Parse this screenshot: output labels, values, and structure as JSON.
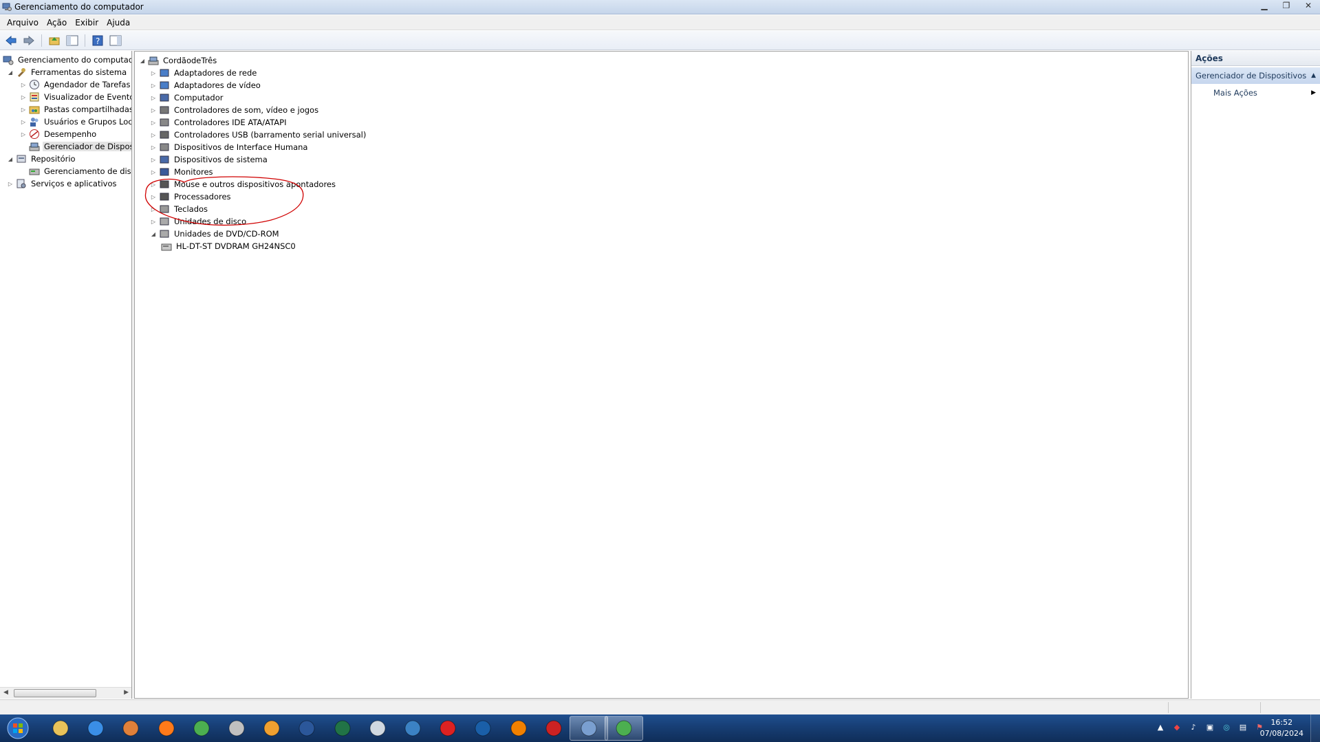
{
  "window": {
    "title": "Gerenciamento do computador"
  },
  "menu": [
    "Arquivo",
    "Ação",
    "Exibir",
    "Ajuda"
  ],
  "toolbar_icons": [
    "back-icon",
    "forward-icon",
    "up-folder-icon",
    "show-hide-tree-icon",
    "help-icon",
    "properties-icon"
  ],
  "left_tree": {
    "root": "Gerenciamento do computado",
    "system_tools": "Ferramentas do sistema",
    "task_scheduler": "Agendador de Tarefas",
    "event_viewer": "Visualizador de Eventos",
    "shared_folders": "Pastas compartilhadas",
    "local_users": "Usuários e Grupos Loca",
    "performance": "Desempenho",
    "device_manager": "Gerenciador de Disposit",
    "storage": "Repositório",
    "disk_management": "Gerenciamento de disco",
    "services": "Serviços e aplicativos"
  },
  "device_tree": {
    "computer_name": "CordãodeTrês",
    "categories": [
      {
        "label": "Adaptadores de rede",
        "icon": "network-adapter-icon"
      },
      {
        "label": "Adaptadores de vídeo",
        "icon": "display-adapter-icon"
      },
      {
        "label": "Computador",
        "icon": "computer-icon"
      },
      {
        "label": "Controladores de som, vídeo e jogos",
        "icon": "sound-icon"
      },
      {
        "label": "Controladores IDE ATA/ATAPI",
        "icon": "ide-controller-icon"
      },
      {
        "label": "Controladores USB (barramento serial universal)",
        "icon": "usb-icon"
      },
      {
        "label": "Dispositivos de Interface Humana",
        "icon": "hid-icon"
      },
      {
        "label": "Dispositivos de sistema",
        "icon": "system-device-icon"
      },
      {
        "label": "Monitores",
        "icon": "monitor-icon"
      },
      {
        "label": "Mouse e outros dispositivos apontadores",
        "icon": "mouse-icon"
      },
      {
        "label": "Processadores",
        "icon": "processor-icon"
      },
      {
        "label": "Teclados",
        "icon": "keyboard-icon"
      },
      {
        "label": "Unidades de disco",
        "icon": "disk-drive-icon"
      },
      {
        "label": "Unidades de DVD/CD-ROM",
        "icon": "dvd-drive-icon"
      }
    ],
    "dvd_device": "HL-DT-ST DVDRAM GH24NSC0",
    "highlight_color": "#d00000"
  },
  "actions": {
    "header": "Ações",
    "section": "Gerenciador de Dispositivos",
    "more": "Mais Ações"
  },
  "taskbar": {
    "apps": [
      "windows-explorer-icon",
      "internet-explorer-icon",
      "media-player-icon",
      "firefox-icon",
      "chrome-icon",
      "tools-icon",
      "pdf-icon",
      "word-icon",
      "excel-icon",
      "calculator-icon",
      "qbittorrent-icon",
      "antivirus-icon",
      "shield-icon",
      "vlc-icon",
      "screen-recorder-icon",
      "computer-management-icon",
      "chrome-alt-icon"
    ],
    "time": "16:52",
    "date": "07/08/2024"
  },
  "colors": {
    "taskbar": "#173e74",
    "accent": "#1e395b",
    "annotation": "#d00000"
  }
}
